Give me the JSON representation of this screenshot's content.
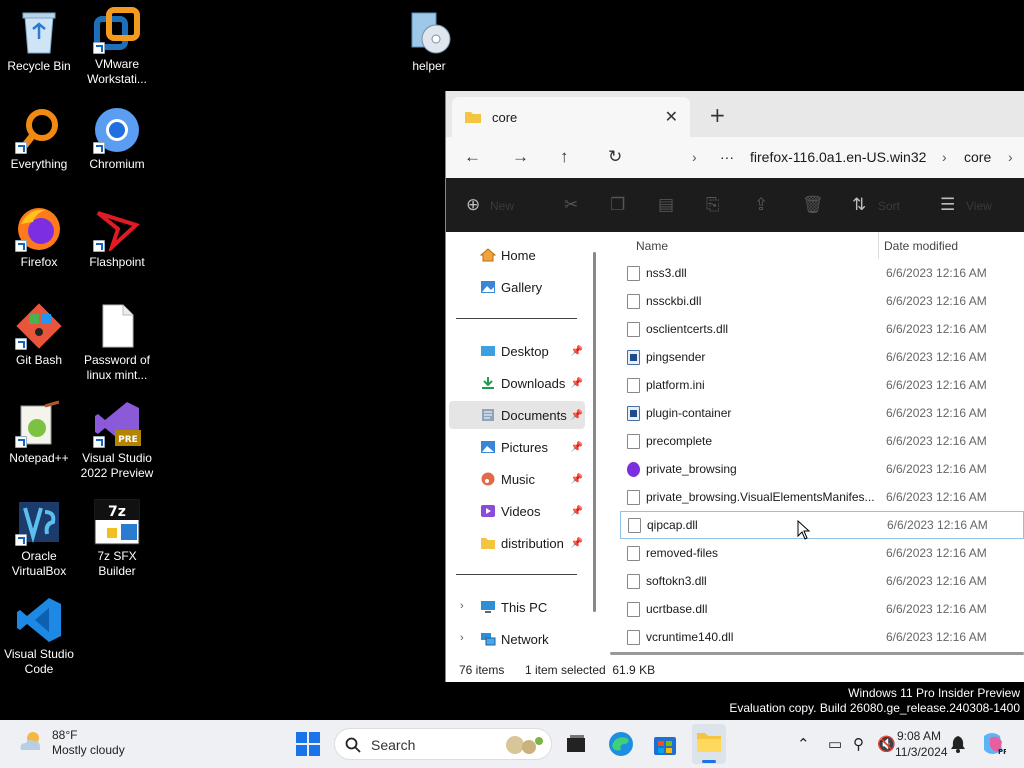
{
  "desktop": {
    "icons": [
      {
        "label": "Recycle Bin",
        "icon": "recycle-bin-icon"
      },
      {
        "label": "VMware Workstati...",
        "icon": "vmware-icon"
      },
      {
        "label": "helper",
        "icon": "helper-disc-icon"
      },
      {
        "label": "Everything",
        "icon": "magnifier-icon"
      },
      {
        "label": "Chromium",
        "icon": "chromium-icon"
      },
      {
        "label": "Firefox",
        "icon": "firefox-icon"
      },
      {
        "label": "Flashpoint",
        "icon": "flashpoint-icon"
      },
      {
        "label": "Git Bash",
        "icon": "git-icon"
      },
      {
        "label": "Password of linux mint...",
        "icon": "document-icon"
      },
      {
        "label": "Notepad++",
        "icon": "notepad-plus-icon"
      },
      {
        "label": "Visual Studio 2022 Preview",
        "icon": "visual-studio-icon"
      },
      {
        "label": "Oracle VirtualBox",
        "icon": "virtualbox-icon"
      },
      {
        "label": "7z SFX Builder",
        "icon": "sevenzip-icon"
      },
      {
        "label": "Visual Studio Code",
        "icon": "vscode-icon"
      }
    ]
  },
  "explorer": {
    "tab_title": "core",
    "breadcrumb": [
      "firefox-116.0a1.en-US.win32",
      "core"
    ],
    "toolbar": {
      "new_label": "New",
      "sort_label": "Sort",
      "view_label": "View"
    },
    "nav": {
      "quick": [
        {
          "label": "Home",
          "icon": "home-icon"
        },
        {
          "label": "Gallery",
          "icon": "gallery-icon"
        }
      ],
      "pinned": [
        {
          "label": "Desktop",
          "icon": "desktop-folder-icon"
        },
        {
          "label": "Downloads",
          "icon": "downloads-icon"
        },
        {
          "label": "Documents",
          "icon": "documents-icon"
        },
        {
          "label": "Pictures",
          "icon": "pictures-icon"
        },
        {
          "label": "Music",
          "icon": "music-icon"
        },
        {
          "label": "Videos",
          "icon": "videos-icon"
        },
        {
          "label": "distribution",
          "icon": "folder-icon"
        }
      ],
      "tree": [
        {
          "label": "This PC",
          "icon": "pc-icon"
        },
        {
          "label": "Network",
          "icon": "network-icon"
        }
      ]
    },
    "columns": {
      "name": "Name",
      "date": "Date modified"
    },
    "files": [
      {
        "name": "nss3.dll",
        "date": "6/6/2023 12:16 AM",
        "type": "dll"
      },
      {
        "name": "nssckbi.dll",
        "date": "6/6/2023 12:16 AM",
        "type": "dll"
      },
      {
        "name": "osclientcerts.dll",
        "date": "6/6/2023 12:16 AM",
        "type": "dll"
      },
      {
        "name": "pingsender",
        "date": "6/6/2023 12:16 AM",
        "type": "app"
      },
      {
        "name": "platform.ini",
        "date": "6/6/2023 12:16 AM",
        "type": "file"
      },
      {
        "name": "plugin-container",
        "date": "6/6/2023 12:16 AM",
        "type": "app"
      },
      {
        "name": "precomplete",
        "date": "6/6/2023 12:16 AM",
        "type": "file"
      },
      {
        "name": "private_browsing",
        "date": "6/6/2023 12:16 AM",
        "type": "private"
      },
      {
        "name": "private_browsing.VisualElementsManifes...",
        "date": "6/6/2023 12:16 AM",
        "type": "file"
      },
      {
        "name": "qipcap.dll",
        "date": "6/6/2023 12:16 AM",
        "type": "dll"
      },
      {
        "name": "removed-files",
        "date": "6/6/2023 12:16 AM",
        "type": "file"
      },
      {
        "name": "softokn3.dll",
        "date": "6/6/2023 12:16 AM",
        "type": "dll"
      },
      {
        "name": "ucrtbase.dll",
        "date": "6/6/2023 12:16 AM",
        "type": "dll"
      },
      {
        "name": "vcruntime140.dll",
        "date": "6/6/2023 12:16 AM",
        "type": "dll"
      }
    ],
    "selected_index": 9,
    "status": {
      "count": "76 items",
      "selection": "1 item selected  61.9 KB"
    }
  },
  "watermark": {
    "line1": "Windows 11 Pro Insider Preview",
    "line2": "Evaluation copy. Build 26080.ge_release.240308-1400"
  },
  "taskbar": {
    "weather_temp": "88°F",
    "weather_desc": "Mostly cloudy",
    "search_label": "Search",
    "time": "9:08 AM",
    "date": "11/3/2024"
  }
}
